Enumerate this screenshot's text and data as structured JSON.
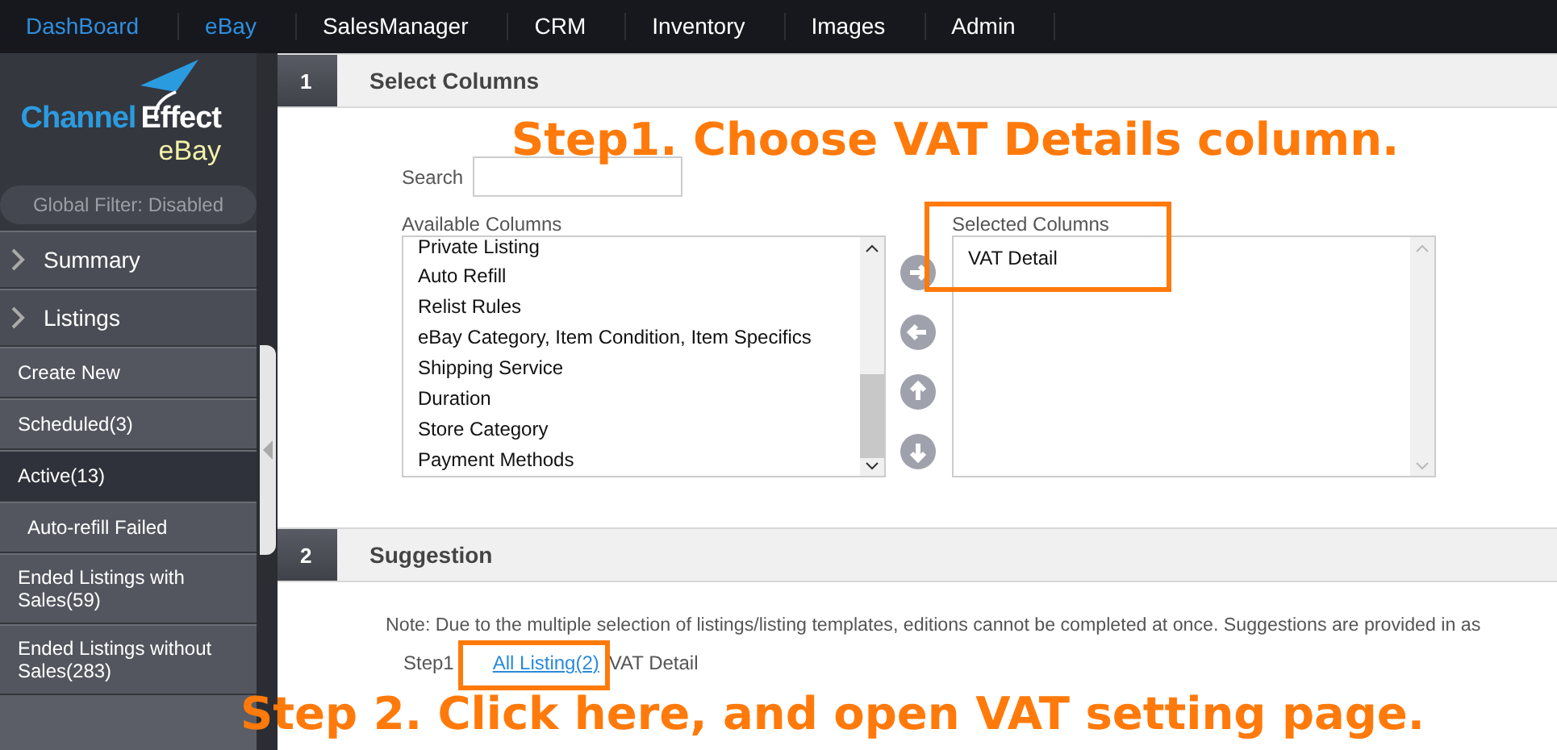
{
  "nav": [
    {
      "label": "DashBoard",
      "highlighted": true
    },
    {
      "label": "eBay",
      "highlighted": true
    },
    {
      "label": "SalesManager",
      "highlighted": false
    },
    {
      "label": "CRM",
      "highlighted": false
    },
    {
      "label": "Inventory",
      "highlighted": false
    },
    {
      "label": "Images",
      "highlighted": false
    },
    {
      "label": "Admin",
      "highlighted": false
    }
  ],
  "sidebar": {
    "logo": {
      "brand_1": "Channel",
      "brand_2": "Effect",
      "product": "eBay"
    },
    "filter": "Global Filter: Disabled",
    "items": [
      {
        "label": "Summary",
        "kind": "section",
        "selected": false
      },
      {
        "label": "Listings",
        "kind": "section",
        "selected": false
      },
      {
        "label": "Create New",
        "kind": "link",
        "selected": false
      },
      {
        "label": "Scheduled(3)",
        "kind": "link",
        "selected": false
      },
      {
        "label": "Active(13)",
        "kind": "link",
        "selected": true
      },
      {
        "label": "Auto-refill Failed",
        "kind": "sublink",
        "selected": false
      },
      {
        "label": "Ended Listings with Sales(59)",
        "kind": "link",
        "selected": false
      },
      {
        "label": "Ended Listings without Sales(283)",
        "kind": "link",
        "selected": false
      }
    ]
  },
  "sections": [
    {
      "number": "1",
      "title": "Select Columns"
    },
    {
      "number": "2",
      "title": "Suggestion"
    }
  ],
  "select_columns": {
    "search_label": "Search",
    "available_label": "Available Columns",
    "available": [
      "Private Listing",
      "Auto Refill",
      "Relist Rules",
      "eBay Category, Item Condition, Item Specifics",
      "Shipping Service",
      "Duration",
      "Store Category",
      "Payment Methods"
    ],
    "selected_label": "Selected Columns",
    "selected": [
      "VAT Detail"
    ]
  },
  "suggestion": {
    "note": "Note: Due to the multiple selection of listings/listing templates, editions cannot be completed at once. Suggestions are provided in as",
    "step_label": "Step1",
    "link": "All Listing(2)",
    "step_text": "VAT Detail"
  },
  "annotations": [
    {
      "text": "Step1. Choose VAT Details column."
    },
    {
      "text": "Step 2. Click here, and open VAT setting page."
    }
  ]
}
